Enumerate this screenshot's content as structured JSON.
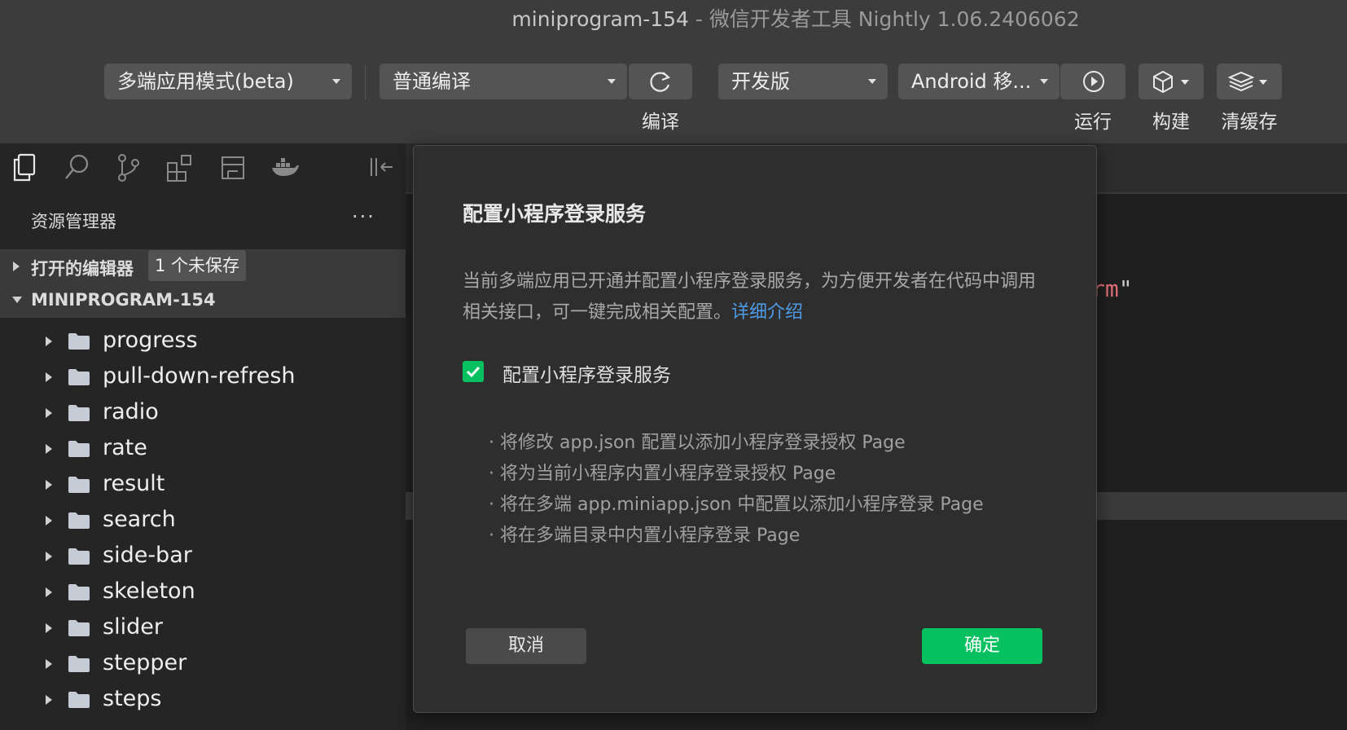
{
  "window": {
    "project": "miniprogram-154",
    "app_title": " - 微信开发者工具 Nightly 1.06.2406062"
  },
  "toolbar": {
    "mode": "多端应用模式(beta)",
    "compile_mode": "普通编译",
    "compile_label": "编译",
    "version": "开发版",
    "device": "Android 移...",
    "run_label": "运行",
    "build_label": "构建",
    "cache_label": "清缓存"
  },
  "sidebar": {
    "panel_title": "资源管理器",
    "more": "···",
    "open_editors": "打开的编辑器",
    "unsaved_badge": "1 个未保存",
    "project_root": "MINIPROGRAM-154",
    "folders": [
      "progress",
      "pull-down-refresh",
      "radio",
      "rate",
      "result",
      "search",
      "side-bar",
      "skeleton",
      "slider",
      "stepper",
      "steps"
    ]
  },
  "editor": {
    "code_fragment": "rm",
    "code_quote": "\""
  },
  "modal": {
    "title": "配置小程序登录服务",
    "description": "当前多端应用已开通并配置小程序登录服务，为方便开发者在代码中调用相关接口，可一键完成相关配置。",
    "link": "详细介绍",
    "checkbox_label": "配置小程序登录服务",
    "checkbox_checked": true,
    "items": [
      "将修改 app.json 配置以添加小程序登录授权 Page",
      "将为当前小程序内置小程序登录授权 Page",
      "将在多端 app.miniapp.json 中配置以添加小程序登录 Page",
      "将在多端目录中内置小程序登录 Page"
    ],
    "cancel": "取消",
    "confirm": "确定"
  },
  "colors": {
    "accent_green": "#07c160",
    "link_blue": "#4e9ce6",
    "toolbar_bg": "#3c3c3c",
    "sidebar_bg": "#252526"
  }
}
